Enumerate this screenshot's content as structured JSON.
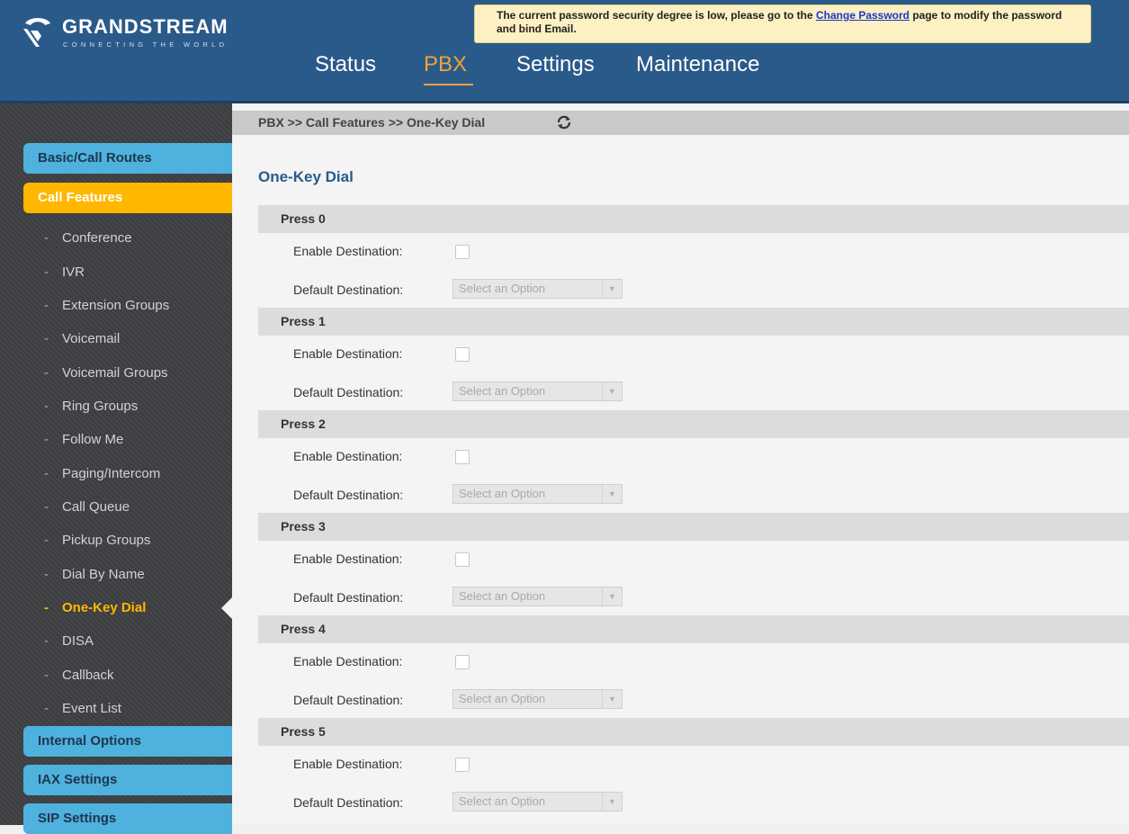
{
  "header": {
    "logo_name": "GRANDSTREAM",
    "logo_tagline": "CONNECTING THE WORLD",
    "notice": {
      "text_before": "The current password security degree is low, please go to the ",
      "link_text": "Change Password",
      "text_after": " page to modify the password and bind Email."
    },
    "nav": [
      {
        "label": "Status",
        "active": false
      },
      {
        "label": "PBX",
        "active": true
      },
      {
        "label": "Settings",
        "active": false
      },
      {
        "label": "Maintenance",
        "active": false
      }
    ]
  },
  "sidebar": {
    "categories": [
      {
        "label": "Basic/Call Routes",
        "active": false
      },
      {
        "label": "Call Features",
        "active": true
      },
      {
        "label": "Internal Options",
        "active": false
      },
      {
        "label": "IAX Settings",
        "active": false
      },
      {
        "label": "SIP Settings",
        "active": false
      }
    ],
    "call_features_items": [
      {
        "label": "Conference",
        "active": false
      },
      {
        "label": "IVR",
        "active": false
      },
      {
        "label": "Extension Groups",
        "active": false
      },
      {
        "label": "Voicemail",
        "active": false
      },
      {
        "label": "Voicemail Groups",
        "active": false
      },
      {
        "label": "Ring Groups",
        "active": false
      },
      {
        "label": "Follow Me",
        "active": false
      },
      {
        "label": "Paging/Intercom",
        "active": false
      },
      {
        "label": "Call Queue",
        "active": false
      },
      {
        "label": "Pickup Groups",
        "active": false
      },
      {
        "label": "Dial By Name",
        "active": false
      },
      {
        "label": "One-Key Dial",
        "active": true
      },
      {
        "label": "DISA",
        "active": false
      },
      {
        "label": "Callback",
        "active": false
      },
      {
        "label": "Event List",
        "active": false
      }
    ],
    "dash": "-"
  },
  "main": {
    "breadcrumb": "PBX >> Call Features >> One-Key Dial",
    "page_title": "One-Key Dial",
    "enable_label": "Enable Destination:",
    "default_label": "Default Destination:",
    "select_placeholder": "Select an Option",
    "sections": [
      {
        "title": "Press 0",
        "enabled": false
      },
      {
        "title": "Press 1",
        "enabled": false
      },
      {
        "title": "Press 2",
        "enabled": false
      },
      {
        "title": "Press 3",
        "enabled": false
      },
      {
        "title": "Press 4",
        "enabled": false
      },
      {
        "title": "Press 5",
        "enabled": false
      }
    ]
  },
  "colors": {
    "header_bg": "#2a5a8a",
    "accent": "#f2a436",
    "category_bg": "#4eb1de",
    "active_category_bg": "#ffb700",
    "notice_bg": "#fdf0c2"
  }
}
